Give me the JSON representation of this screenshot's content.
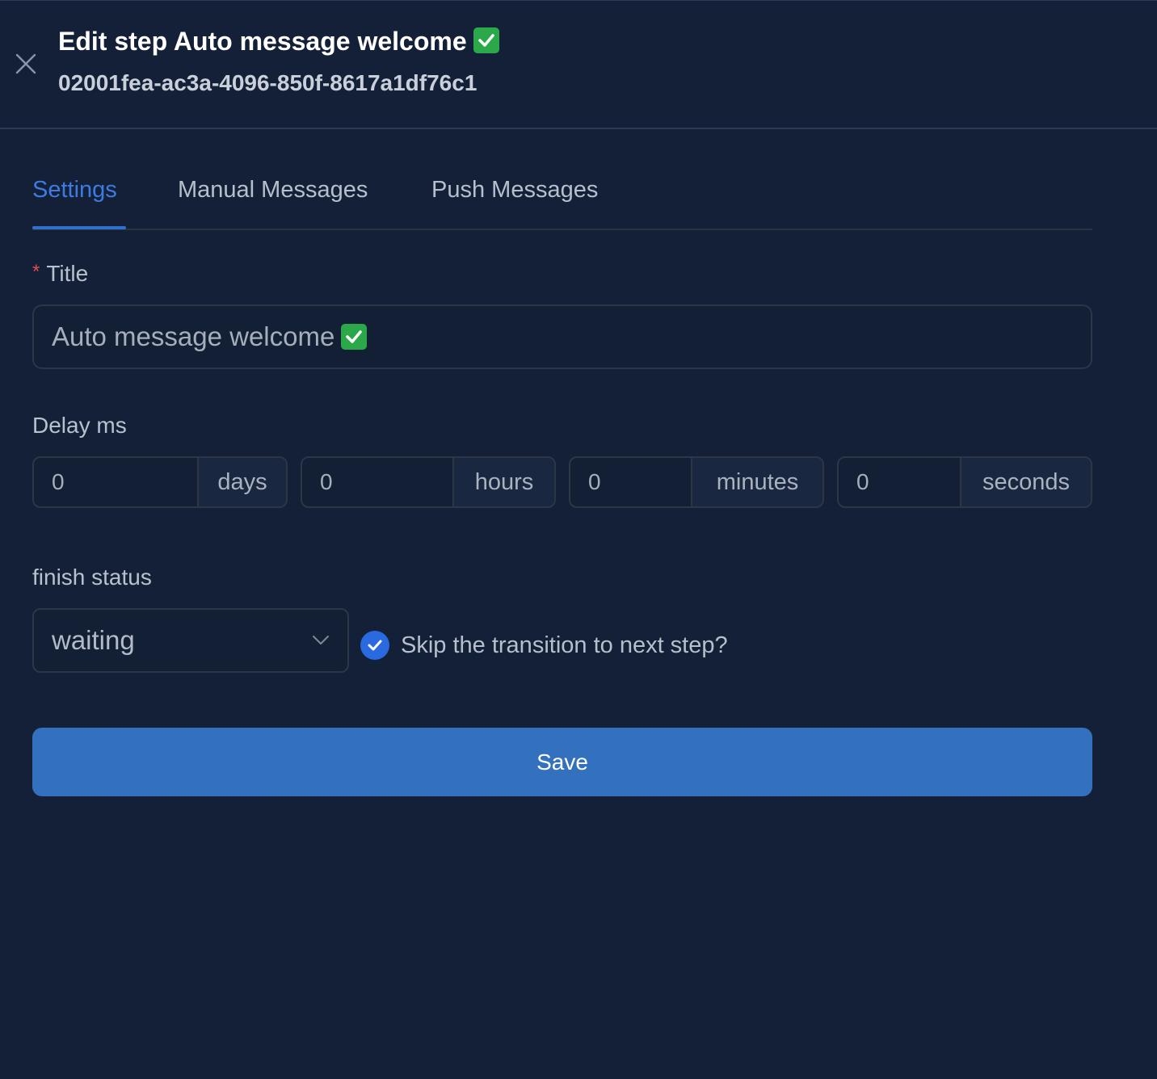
{
  "header": {
    "title": "Edit step Auto message welcome",
    "subtitle": "02001fea-ac3a-4096-850f-8617a1df76c1",
    "title_icon": "check-mark-emoji"
  },
  "tabs": [
    {
      "label": "Settings",
      "active": true
    },
    {
      "label": "Manual Messages",
      "active": false
    },
    {
      "label": "Push Messages",
      "active": false
    }
  ],
  "form": {
    "title_label": "Title",
    "required_marker": "*",
    "title_value": "Auto message welcome",
    "delay_label": "Delay ms",
    "delay": [
      {
        "value": "0",
        "unit": "days"
      },
      {
        "value": "0",
        "unit": "hours"
      },
      {
        "value": "0",
        "unit": "minutes"
      },
      {
        "value": "0",
        "unit": "seconds"
      }
    ],
    "finish_status_label": "finish status",
    "finish_status_value": "waiting",
    "skip_label": "Skip the transition to next step?",
    "skip_checked": true,
    "save_label": "Save"
  },
  "colors": {
    "background": "#132037",
    "accent": "#3371bf",
    "tab_active": "#3d7be0",
    "checkbox": "#2a6ae0",
    "emoji_green": "#2aa84a"
  }
}
